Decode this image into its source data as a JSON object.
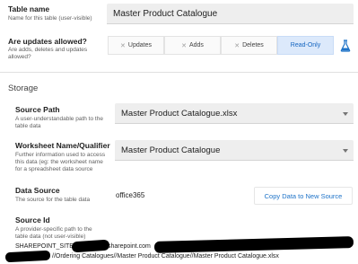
{
  "table_name": {
    "title": "Table name",
    "desc": "Name for this table (user-visible)",
    "value": "Master Product Catalogue"
  },
  "updates": {
    "title": "Are updates allowed?",
    "desc_line1": "Are adds, deletes and updates",
    "desc_line2": "allowed?",
    "options": [
      {
        "label": "Updates",
        "selected": false
      },
      {
        "label": "Adds",
        "selected": false
      },
      {
        "label": "Deletes",
        "selected": false
      },
      {
        "label": "Read-Only",
        "selected": true
      }
    ],
    "beaker_icon": "flask-icon"
  },
  "storage": {
    "section_title": "Storage",
    "source_path": {
      "title": "Source Path",
      "desc_line1": "A user-understandable path to the",
      "desc_line2": "table data",
      "value": "Master Product Catalogue.xlsx"
    },
    "worksheet": {
      "title": "Worksheet Name/Qualifier",
      "desc_line1": "Further information used to access",
      "desc_line2": "this data (eg: the worksheet name",
      "desc_line3": "for a spreadsheet data source",
      "value": "Master Product Catalogue"
    },
    "data_source": {
      "title": "Data Source",
      "desc": "The source for the table data",
      "value": "office365",
      "copy_button": "Copy Data to New Source"
    },
    "source_id": {
      "title": "Source Id",
      "desc_line1": "A provider-specific path to the",
      "desc_line2": "table data (not user-visible)",
      "line1_prefix": "SHAREPOINT_SITE_S",
      "line1_mid": "sharepoint.com",
      "line2_suffix": "//Ordering Catalogues//Master Product Catalogue//Master Product Catalogue.xlsx"
    }
  },
  "colors": {
    "accent": "#1e73c8",
    "selected_segment_bg": "#dce9fb",
    "field_bg": "#eeeeee"
  }
}
